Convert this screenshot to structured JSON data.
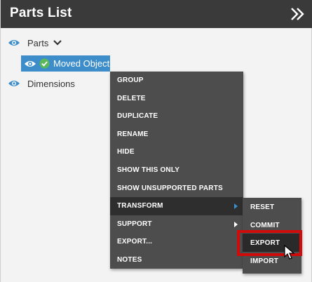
{
  "header": {
    "title": "Parts List",
    "collapse_icon": "double-chevron-right-icon"
  },
  "tree": {
    "parts": {
      "label": "Parts",
      "icon": "eye-icon",
      "toggle_icon": "chevron-down-icon"
    },
    "moved_object": {
      "label": "Moved Object",
      "icon": "eye-icon",
      "status_icon": "check-circle-icon",
      "status_color": "#5cb85c",
      "selected_color": "#3c8dc9"
    },
    "dimensions": {
      "label": "Dimensions",
      "icon": "eye-icon"
    }
  },
  "context_menu": {
    "items": [
      {
        "label": "GROUP"
      },
      {
        "label": "DELETE"
      },
      {
        "label": "DUPLICATE"
      },
      {
        "label": "RENAME"
      },
      {
        "label": "HIDE"
      },
      {
        "label": "SHOW THIS ONLY"
      },
      {
        "label": "SHOW UNSUPPORTED PARTS"
      },
      {
        "label": "TRANSFORM",
        "has_submenu": true,
        "active": true
      },
      {
        "label": "SUPPORT",
        "has_submenu": true
      },
      {
        "label": "EXPORT..."
      },
      {
        "label": "NOTES"
      }
    ]
  },
  "submenu": {
    "items": [
      {
        "label": "RESET"
      },
      {
        "label": "COMMIT"
      },
      {
        "label": "EXPORT",
        "highlighted": true
      },
      {
        "label": "IMPORT"
      }
    ],
    "highlight_color": "#d10a0a"
  }
}
